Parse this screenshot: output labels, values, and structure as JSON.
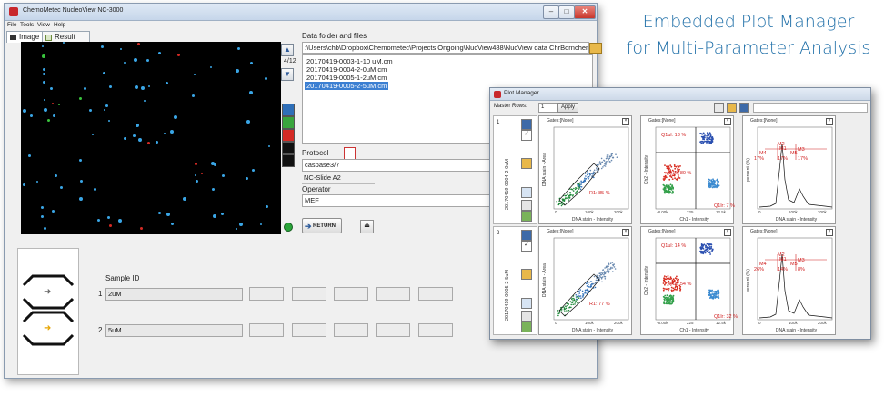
{
  "headline": {
    "line1": "Embedded Plot Manager",
    "line2": "for Multi-Parameter Analysis"
  },
  "main_window": {
    "title": "ChemoMetec NucleoView NC-3000",
    "menu": [
      "File",
      "Tools",
      "View",
      "Help"
    ],
    "tabs": [
      {
        "label": "Image"
      },
      {
        "label": "Result"
      }
    ],
    "image_counter": "4/12",
    "data_folder_label": "Data folder and files",
    "data_folder_path": ":\\Users\\chb\\Dropbox\\Chemometec\\Projects Ongoing\\NucView488\\NucView data ChrBornchen",
    "files": [
      {
        "name": "20170419-0003-1-10 uM.cm",
        "selected": false
      },
      {
        "name": "20170419-0004-2-0uM.cm",
        "selected": false
      },
      {
        "name": "20170419-0005-1-2uM.cm",
        "selected": false
      },
      {
        "name": "20170419-0005-2-5uM.cm",
        "selected": true
      }
    ],
    "protocol_label": "Protocol",
    "protocol_value": "caspase3/7",
    "slide_value": "NC-Slide A2",
    "operator_label": "Operator",
    "operator_value": "MEF",
    "return_label": "RETURN",
    "sample_id_label": "Sample ID",
    "samples": [
      {
        "num": "1",
        "id": "2uM"
      },
      {
        "num": "2",
        "id": "5uM"
      }
    ],
    "swatch_colors": [
      "#2f6fb8",
      "#39a53d",
      "#d42a24",
      "#111111",
      "#111111"
    ]
  },
  "plot_manager": {
    "title": "Plot Manager",
    "master_rows_label": "Master Rows:",
    "master_rows_value": "1",
    "apply_label": "Apply",
    "rows": [
      {
        "num": "1",
        "sample_name": "20170419-0004-2-0uM",
        "plots": [
          {
            "gates": "Gates:[None]",
            "xlabel": "DNA stain - Intensity",
            "ylabel": "DNA stain - Area",
            "annotations": [
              "R1: 85 %"
            ],
            "x_ticks": [
              "0",
              "100k",
              "200k"
            ]
          },
          {
            "gates": "Gates:[None]",
            "xlabel": "Ch1 - Intensity",
            "ylabel": "Ch2 - Intensity",
            "annotations": [
              "Q1ul: 13 %",
              "Q1ll: 80 %",
              "Q1lr: 7 %"
            ],
            "x_ticks": [
              "-8.00k",
              "225",
              "12.5k"
            ]
          },
          {
            "gates": "Gates:[None]",
            "xlabel": "DNA stain - Intensity",
            "ylabel": "percent (%)",
            "annotations": [
              "M2",
              "M1",
              "M3",
              "M4",
              "M5",
              "17%",
              "17%",
              "17%"
            ],
            "x_ticks": [
              "0",
              "100k",
              "200k"
            ]
          }
        ]
      },
      {
        "num": "2",
        "sample_name": "20170419-0005-2-5uM",
        "plots": [
          {
            "gates": "Gates:[None]",
            "xlabel": "DNA stain - Intensity",
            "ylabel": "DNA stain - Area",
            "annotations": [
              "R1: 77 %"
            ],
            "x_ticks": [
              "0",
              "100k",
              "200k"
            ]
          },
          {
            "gates": "Gates:[None]",
            "xlabel": "Ch1 - Intensity",
            "ylabel": "Ch2 - Intensity",
            "annotations": [
              "Q1ul: 14 %",
              "Q1ll: 54 %",
              "Q1lr: 32 %"
            ],
            "x_ticks": [
              "-8.00k",
              "225",
              "12.5k"
            ]
          },
          {
            "gates": "Gates:[None]",
            "xlabel": "DNA stain - Intensity",
            "ylabel": "percent (%)",
            "annotations": [
              "M2",
              "M1",
              "M3",
              "M4",
              "M5",
              "26%",
              "14%",
              "8%"
            ],
            "x_ticks": [
              "0",
              "100k",
              "200k"
            ]
          }
        ]
      }
    ]
  },
  "icons": [
    "app-icon",
    "minimize-icon",
    "maximize-icon",
    "close-icon",
    "camera-icon",
    "chart-icon",
    "up-arrow-icon",
    "down-arrow-icon",
    "folder-icon",
    "pdf-icon",
    "eject-icon",
    "arrow-right-icon",
    "save-icon",
    "checkbox-icon",
    "grid-icon",
    "histogram-icon"
  ]
}
